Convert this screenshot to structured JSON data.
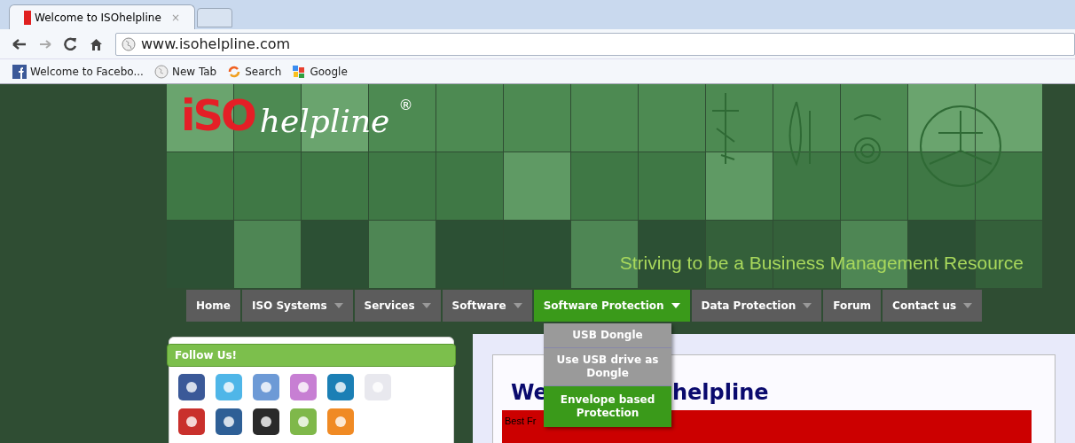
{
  "browser": {
    "tabs": [
      {
        "title": "Welcome to ISOhelpline",
        "close": "×",
        "selected": true
      }
    ],
    "address": "www.isohelpline.com",
    "bookmarks": [
      {
        "label": "Welcome to Facebo...",
        "kind": "facebook"
      },
      {
        "label": "New Tab",
        "kind": "globe"
      },
      {
        "label": "Search",
        "kind": "search"
      },
      {
        "label": "Google",
        "kind": "google"
      }
    ]
  },
  "header": {
    "logo": {
      "mark": "iSO",
      "word": "helpline",
      "registered": "®"
    },
    "tagline": "Striving to be a Business Management Resource"
  },
  "menu": [
    {
      "label": "Home",
      "has_submenu": false,
      "selected": false
    },
    {
      "label": "ISO Systems",
      "has_submenu": true,
      "selected": false
    },
    {
      "label": "Services",
      "has_submenu": true,
      "selected": false
    },
    {
      "label": "Software",
      "has_submenu": true,
      "selected": false
    },
    {
      "label": "Software Protection",
      "has_submenu": true,
      "selected": true
    },
    {
      "label": "Data Protection",
      "has_submenu": true,
      "selected": false
    },
    {
      "label": "Forum",
      "has_submenu": false,
      "selected": false
    },
    {
      "label": "Contact us",
      "has_submenu": true,
      "selected": false
    }
  ],
  "submenu": [
    {
      "label": "USB Dongle",
      "selected": false
    },
    {
      "label": "Use USB drive as Dongle",
      "selected": false
    },
    {
      "label": "Envelope based Protection",
      "selected": true
    }
  ],
  "sidebar": {
    "title": "Follow Us!",
    "icons": [
      {
        "color": "#3b5998"
      },
      {
        "color": "#4fb6e8"
      },
      {
        "color": "#6d9ad6"
      },
      {
        "color": "#c77fd3"
      },
      {
        "color": "#1b7fb5"
      },
      {
        "color": "#e8e8ee"
      },
      {
        "color": "#c9302c"
      },
      {
        "color": "#2e5f96"
      },
      {
        "color": "#2a2a2a"
      },
      {
        "color": "#7fb84a"
      },
      {
        "color": "#f08a24"
      }
    ]
  },
  "content": {
    "heading_start": "We",
    "heading_end": "helpline",
    "banner_text": "Best Fr"
  }
}
